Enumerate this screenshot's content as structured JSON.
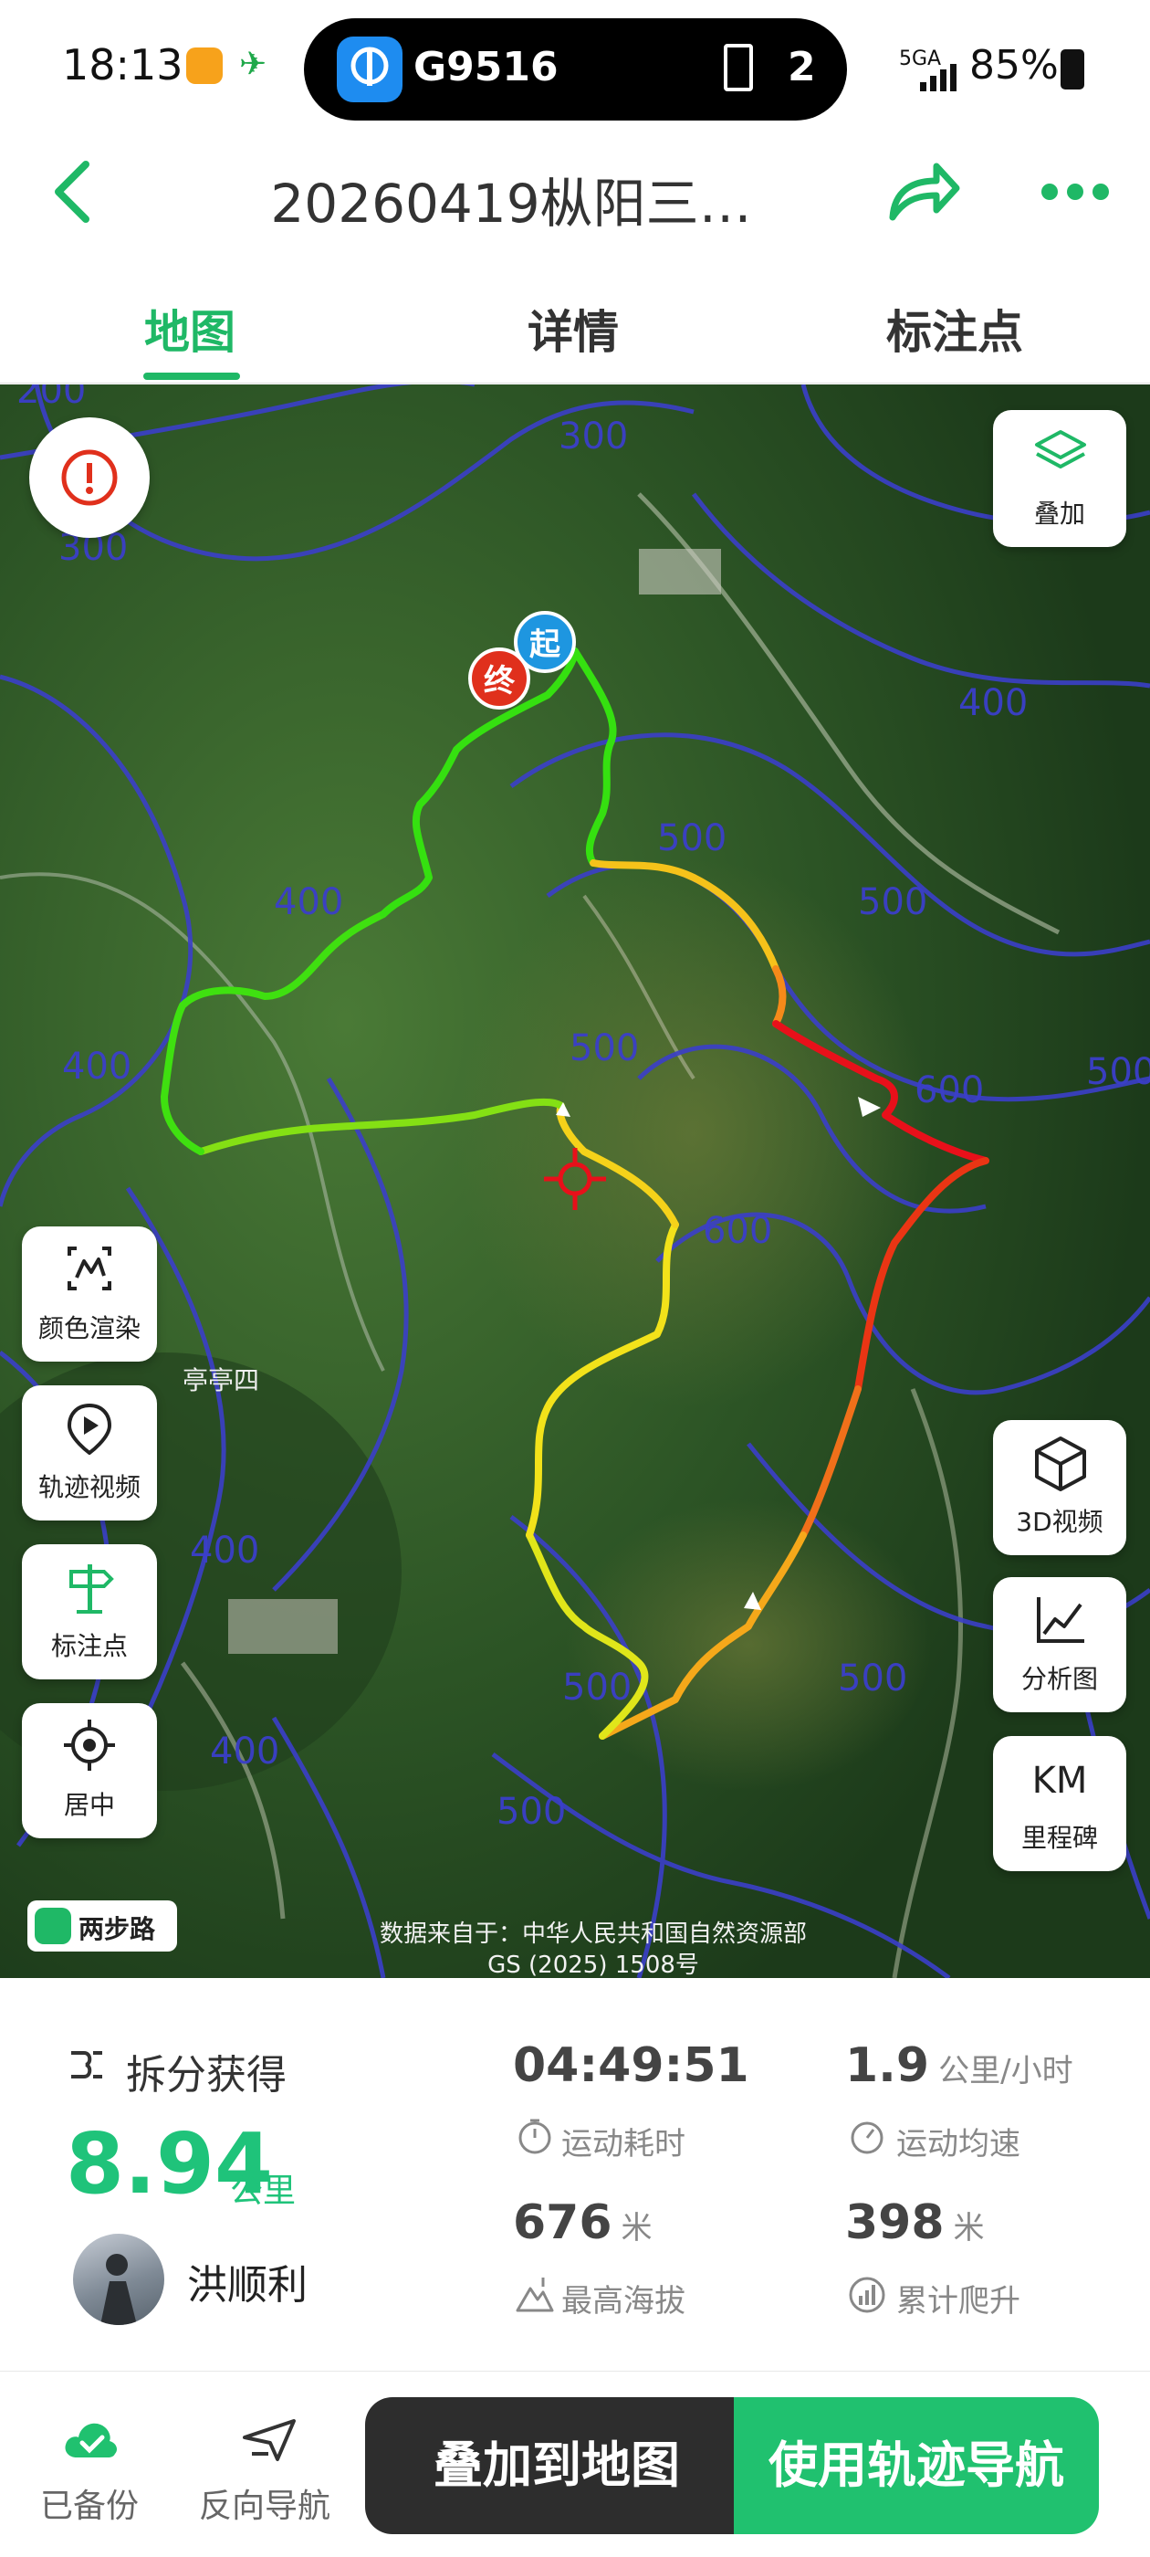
{
  "status_bar": {
    "time": "18:13",
    "train": "G9516",
    "car_count": "2",
    "network": "5GA",
    "battery": "85%"
  },
  "header": {
    "title": "20260419枞阳三…",
    "back_icon": "back-arrow-icon",
    "share_icon": "share-icon",
    "more_icon": "more-icon"
  },
  "tabs": [
    {
      "label": "地图",
      "active": true
    },
    {
      "label": "详情",
      "active": false
    },
    {
      "label": "标注点",
      "active": false
    }
  ],
  "map": {
    "contours": [
      "200",
      "300",
      "300",
      "400",
      "400",
      "500",
      "500",
      "500",
      "400",
      "600",
      "500",
      "600",
      "400",
      "400",
      "500",
      "500",
      "500"
    ],
    "start_label": "起",
    "end_label": "终",
    "place_label": "亭亭四",
    "brand": "两步路",
    "credit_line1": "数据来自于：中华人民共和国自然资源部",
    "credit_line2": "GS (2025) 1508号",
    "overlay_button": "叠加",
    "left_tools": [
      {
        "label": "颜色渲染",
        "icon": "color-render-icon"
      },
      {
        "label": "轨迹视频",
        "icon": "track-video-icon"
      },
      {
        "label": "标注点",
        "icon": "waypoint-sign-icon"
      },
      {
        "label": "居中",
        "icon": "center-target-icon"
      }
    ],
    "right_tools": [
      {
        "label": "3D视频",
        "icon": "cube-3d-icon"
      },
      {
        "label": "分析图",
        "icon": "chart-analysis-icon"
      },
      {
        "label": "里程碑",
        "glyph": "KM"
      }
    ]
  },
  "stats": {
    "split_label": "拆分获得",
    "distance": "8.94",
    "distance_unit": "公里",
    "user_name": "洪顺利",
    "duration": "04:49:51",
    "duration_label": "运动耗时",
    "speed": "1.9",
    "speed_unit": "公里/小时",
    "speed_label": "运动均速",
    "max_alt": "676",
    "max_alt_unit": "米",
    "max_alt_label": "最高海拔",
    "climb": "398",
    "climb_unit": "米",
    "climb_label": "累计爬升"
  },
  "bottom_bar": {
    "backup_label": "已备份",
    "reverse_label": "反向导航",
    "overlay_btn": "叠加到地图",
    "navigate_btn": "使用轨迹导航"
  },
  "colors": {
    "accent": "#1fb866",
    "contour": "#3b3fc9",
    "track_start": "#35e010",
    "track_mid": "#f2e21a",
    "track_peak": "#e8101a"
  }
}
